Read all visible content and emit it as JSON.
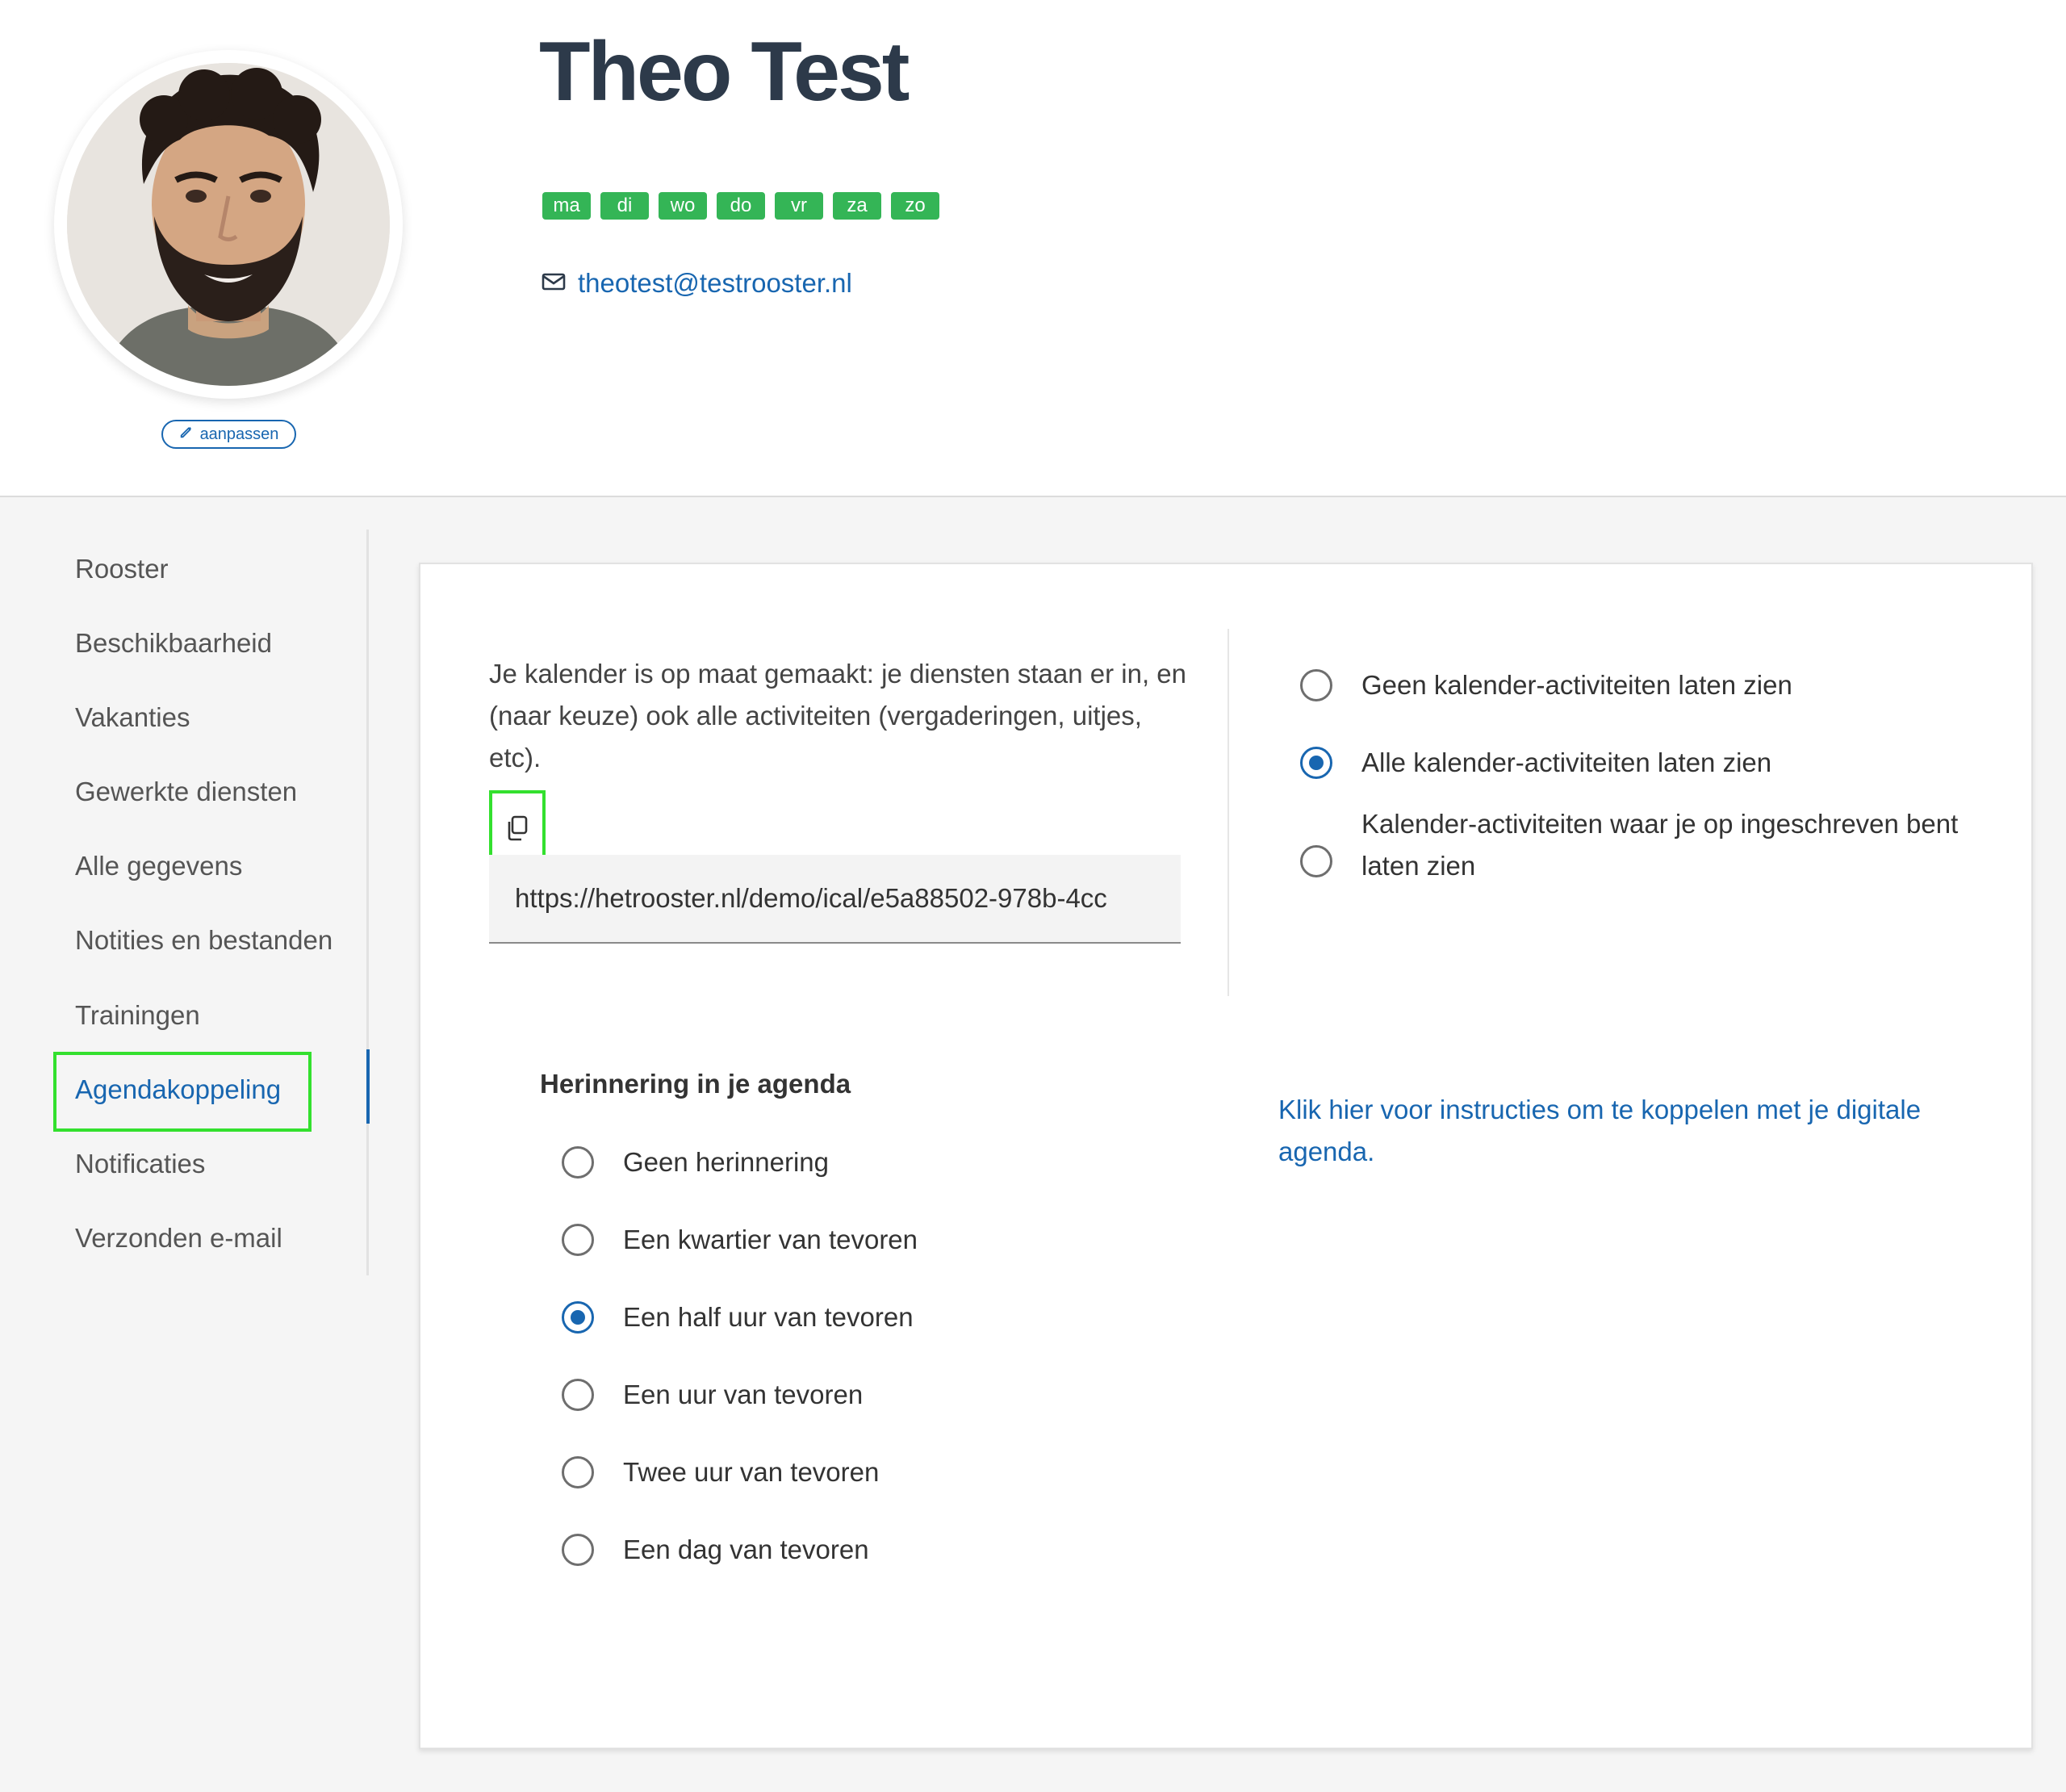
{
  "profile": {
    "name": "Theo Test",
    "edit_photo_label": "aanpassen",
    "email": "theotest@testrooster.nl",
    "days": [
      "ma",
      "di",
      "wo",
      "do",
      "vr",
      "za",
      "zo"
    ]
  },
  "sidebar": {
    "items": [
      {
        "label": "Rooster"
      },
      {
        "label": "Beschikbaarheid"
      },
      {
        "label": "Vakanties"
      },
      {
        "label": "Gewerkte diensten"
      },
      {
        "label": "Alle gegevens"
      },
      {
        "label": "Notities en bestanden"
      },
      {
        "label": "Trainingen"
      },
      {
        "label": "Agendakoppeling"
      },
      {
        "label": "Notificaties"
      },
      {
        "label": "Verzonden e-mail"
      }
    ],
    "active_index": 7
  },
  "calendar": {
    "intro": "Je kalender is op maat gemaakt: je diensten staan er in, en (naar keuze) ook alle activiteiten (vergaderingen, uitjes, etc).",
    "ical_url": "https://hetrooster.nl/demo/ical/e5a88502-978b-4cc",
    "activity_options": [
      {
        "label": "Geen kalender-activiteiten laten zien",
        "checked": false
      },
      {
        "label": "Alle kalender-activiteiten laten zien",
        "checked": true
      },
      {
        "label": "Kalender-activiteiten waar je op ingeschreven bent laten zien",
        "checked": false
      }
    ],
    "reminder_title": "Herinnering in je agenda",
    "reminder_options": [
      {
        "label": "Geen herinnering",
        "checked": false
      },
      {
        "label": "Een kwartier van tevoren",
        "checked": false
      },
      {
        "label": "Een half uur van tevoren",
        "checked": true
      },
      {
        "label": "Een uur van tevoren",
        "checked": false
      },
      {
        "label": "Twee uur van tevoren",
        "checked": false
      },
      {
        "label": "Een dag van tevoren",
        "checked": false
      }
    ],
    "instructions_link": "Klik hier voor instructies om te koppelen met je digitale agenda."
  },
  "icons": {
    "edit": "pencil-icon",
    "email": "envelope-icon",
    "copy": "copy-icon"
  },
  "colors": {
    "accent": "#1866b0",
    "day_badge": "#34b556",
    "highlight": "#33e02e",
    "name": "#2d3a4a"
  }
}
